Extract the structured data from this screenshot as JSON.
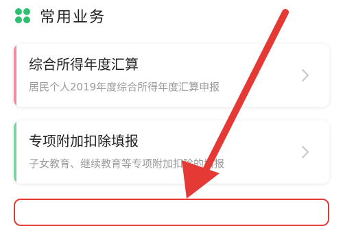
{
  "section": {
    "icon": "grid-apps-icon",
    "title": "常用业务"
  },
  "cards": [
    {
      "title": "综合所得年度汇算",
      "subtitle": "居民个人2019年度综合所得年度汇算申报",
      "accent_color": "#f28ca0",
      "icon": "chevron-right-icon"
    },
    {
      "title": "专项附加扣除填报",
      "subtitle": "子女教育、继续教育等专项附加扣除的填报",
      "accent_color": "#7dd3a0",
      "icon": "chevron-right-icon"
    }
  ],
  "colors": {
    "brand_green": "#2fbf71",
    "annotation_red": "#e53935"
  }
}
